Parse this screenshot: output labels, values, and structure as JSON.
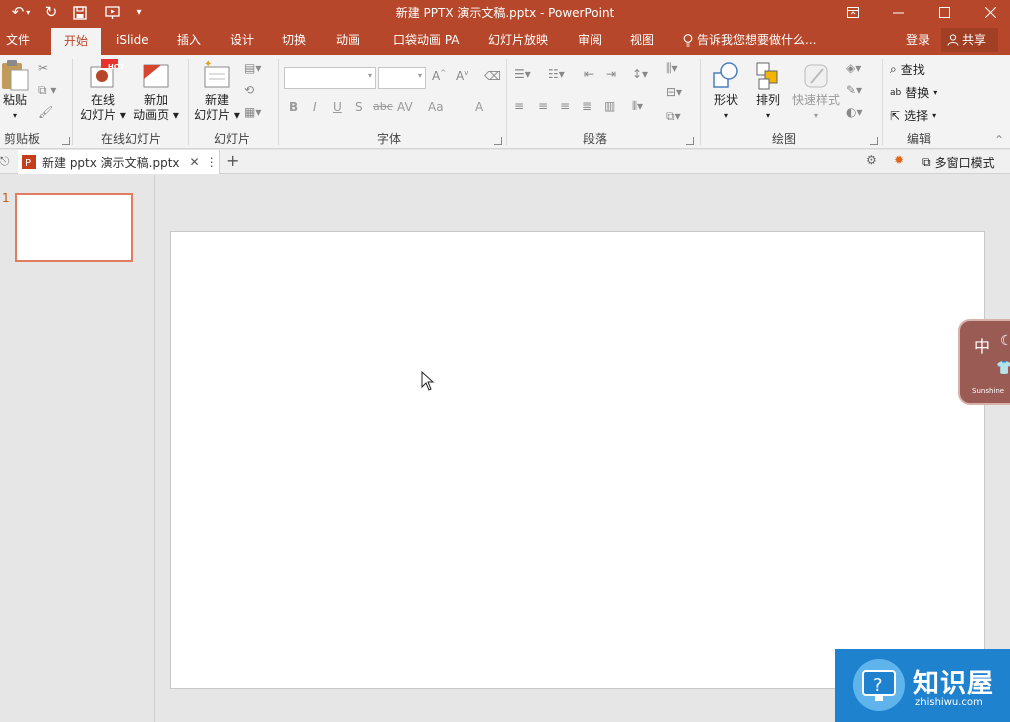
{
  "window": {
    "title": "新建 PPTX 演示文稿.pptx - PowerPoint"
  },
  "ribbon_tabs": [
    "文件",
    "开始",
    "iSlide",
    "插入",
    "设计",
    "切换",
    "动画",
    "口袋动画 PA",
    "幻灯片放映",
    "审阅",
    "视图"
  ],
  "tell_me": "告诉我您想要做什么...",
  "account": {
    "login": "登录",
    "share": "共享"
  },
  "groups": {
    "clipboard": {
      "label": "剪贴板",
      "paste": "粘贴"
    },
    "online": {
      "label": "在线幻灯片",
      "online_slide": "在线\n幻灯片",
      "online_slide_line1": "在线",
      "online_slide_line2": "幻灯片",
      "new_anim_line1": "新加",
      "new_anim_line2": "动画页",
      "hot": "HOT"
    },
    "slides": {
      "label": "幻灯片",
      "new_line1": "新建",
      "new_line2": "幻灯片"
    },
    "font": {
      "label": "字体",
      "bold": "B",
      "italic": "I",
      "underline": "U",
      "shadow": "S",
      "strike": "abc",
      "spacing": "AV",
      "case": "Aa",
      "color": "A"
    },
    "paragraph": {
      "label": "段落"
    },
    "drawing": {
      "label": "绘图",
      "shapes": "形状",
      "arrange": "排列",
      "quick_styles": "快速样式"
    },
    "editing": {
      "label": "编辑",
      "find": "查找",
      "replace": "替换",
      "select": "选择"
    }
  },
  "doc_tab": {
    "name": "新建 pptx 演示文稿.pptx",
    "multiwindow": "多窗口模式"
  },
  "thumbnails": [
    {
      "number": "1"
    }
  ],
  "widget": {
    "char": "中",
    "brand": "Sunshine"
  },
  "watermark": {
    "name": "知识屋",
    "url": "zhishiwu.com"
  },
  "colors": {
    "accent": "#b7472a",
    "thumb_border": "#e17d5d",
    "watermark": "#1e82cf"
  }
}
